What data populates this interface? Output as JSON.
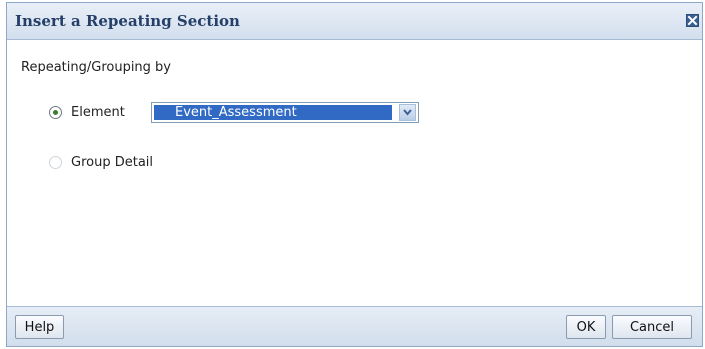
{
  "dialog": {
    "title": "Insert a Repeating Section",
    "close_icon": "close-icon"
  },
  "repeating": {
    "group_label": "Repeating/Grouping by",
    "options": [
      {
        "label": "Element",
        "selected": true
      },
      {
        "label": "Group Detail",
        "selected": false
      }
    ],
    "element_select": {
      "value": "Event_Assessment",
      "arrow_icon": "chevron-down-icon"
    }
  },
  "footer": {
    "help_label": "Help",
    "ok_label": "OK",
    "cancel_label": "Cancel"
  }
}
